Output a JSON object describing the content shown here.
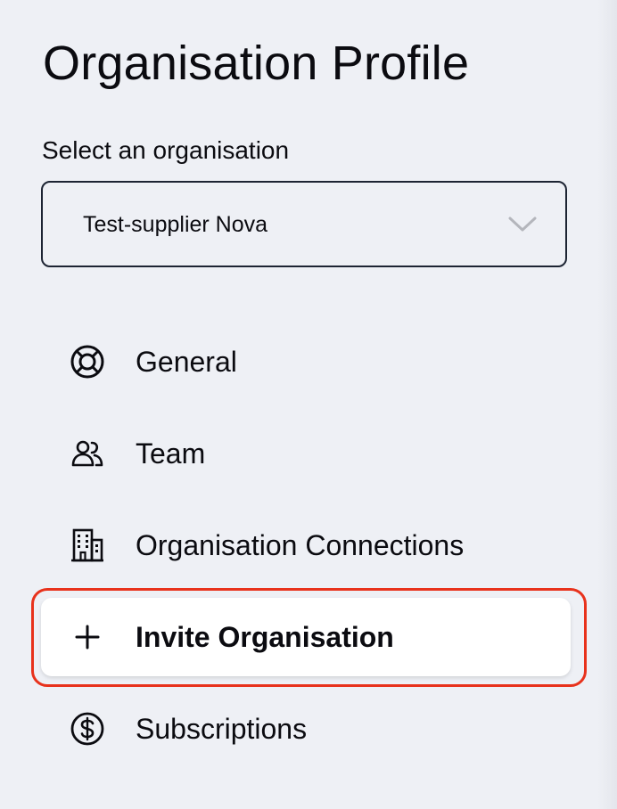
{
  "page": {
    "title": "Organisation Profile"
  },
  "org_select": {
    "label": "Select an organisation",
    "value": "Test-supplier Nova"
  },
  "nav": {
    "items": [
      {
        "label": "General",
        "icon": "lifebuoy-icon",
        "active": false
      },
      {
        "label": "Team",
        "icon": "users-icon",
        "active": false
      },
      {
        "label": "Organisation Connections",
        "icon": "building-icon",
        "active": false
      },
      {
        "label": "Invite Organisation",
        "icon": "plus-icon",
        "active": true
      },
      {
        "label": "Subscriptions",
        "icon": "dollar-circle-icon",
        "active": false
      }
    ]
  },
  "highlight": {
    "target": "Invite Organisation",
    "color": "#e8321c"
  },
  "colors": {
    "background": "#eef0f5",
    "text": "#0b0b10",
    "active_item_bg": "#ffffff",
    "select_border": "#1d2433",
    "chevron": "#b4b6bc"
  }
}
